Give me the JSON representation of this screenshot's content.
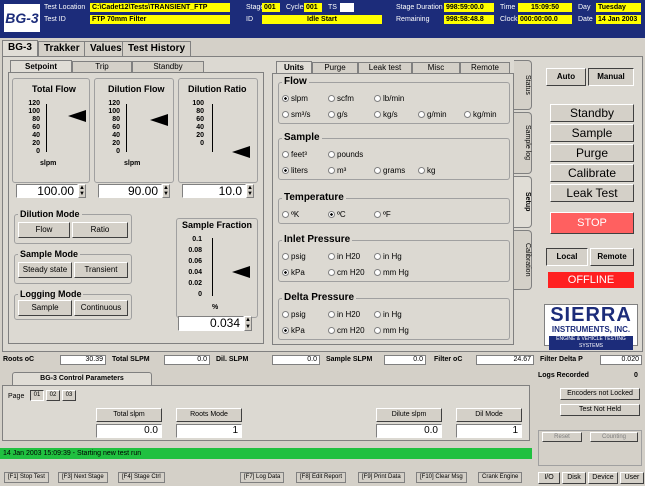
{
  "header": {
    "logo": "BG-3",
    "test_location_label": "Test Location",
    "test_location": "C:\\Cadet12\\Tests\\TRANSIENT_FTP",
    "test_id_label": "Test ID",
    "test_id": "FTP 70mm Filter",
    "stage_label": "Stage",
    "stage": "001",
    "cycle_label": "Cycle",
    "cycle": "001",
    "ts_label": "TS",
    "id_label": "ID",
    "status": "Idle Start",
    "stage_duration_label": "Stage Duration",
    "stage_duration": "998:59:00.0",
    "remaining_label": "Remaining",
    "remaining": "998:58:48.8",
    "time_label": "Time",
    "time": "15:09:50",
    "clock_label": "Clock",
    "clock": "000:00:00.0",
    "day_label": "Day",
    "day": "Tuesday",
    "date_label": "Date",
    "date": "14 Jan 2003"
  },
  "main_tabs": [
    "BG-3",
    "Trakker",
    "Values",
    "Test History"
  ],
  "left_tabs": [
    "Setpoint",
    "Trip",
    "Standby"
  ],
  "flows": [
    {
      "title": "Total Flow",
      "ticks": [
        "120",
        "100",
        "80",
        "60",
        "40",
        "20",
        "0"
      ],
      "unit": "slpm",
      "value": "100.00",
      "level": 0.83
    },
    {
      "title": "Dilution Flow",
      "ticks": [
        "120",
        "100",
        "80",
        "60",
        "40",
        "20",
        "0"
      ],
      "unit": "slpm",
      "value": "90.00",
      "level": 0.75
    },
    {
      "title": "Dilution Ratio",
      "ticks": [
        "100",
        "80",
        "60",
        "40",
        "20",
        "0"
      ],
      "unit": "",
      "value": "10.0",
      "level": 0.1
    }
  ],
  "dilution_mode": {
    "title": "Dilution Mode",
    "options": [
      "Flow",
      "Ratio"
    ]
  },
  "sample_mode": {
    "title": "Sample Mode",
    "options": [
      "Steady state",
      "Transient"
    ]
  },
  "logging_mode": {
    "title": "Logging Mode",
    "options": [
      "Sample",
      "Continuous"
    ]
  },
  "sample_fraction": {
    "title": "Sample Fraction",
    "ticks": [
      "0.1",
      "0.08",
      "0.06",
      "0.04",
      "0.02",
      "0"
    ],
    "unit": "%",
    "value": "0.034",
    "level": 0.34
  },
  "right_tabs": [
    "Units",
    "Purge",
    "Leak test",
    "Misc",
    "Remote"
  ],
  "units": {
    "flow": {
      "title": "Flow",
      "row1": [
        "slpm",
        "scfm",
        "lb/min"
      ],
      "row2": [
        "sm³/s",
        "g/s",
        "kg/s",
        "g/min",
        "kg/min"
      ]
    },
    "sample": {
      "title": "Sample",
      "row1": [
        "feet³",
        "pounds"
      ],
      "row2": [
        "liters",
        "m³",
        "grams",
        "kg"
      ]
    },
    "temperature": {
      "title": "Temperature",
      "row1": [
        "ºK",
        "ºC",
        "ºF"
      ]
    },
    "inlet_pressure": {
      "title": "Inlet Pressure",
      "row1": [
        "psig",
        "in H20",
        "in Hg"
      ],
      "row2": [
        "kPa",
        "cm H20",
        "mm Hg"
      ]
    },
    "delta_pressure": {
      "title": "Delta Pressure",
      "row1": [
        "psig",
        "in H20",
        "in Hg"
      ],
      "row2": [
        "kPa",
        "cm H20",
        "mm Hg"
      ]
    }
  },
  "side_tabs": [
    "Status",
    "Sample log",
    "Setup",
    "Calibration"
  ],
  "controls": {
    "auto": "Auto",
    "manual": "Manual",
    "standby": "Standby",
    "sample": "Sample",
    "purge": "Purge",
    "calibrate": "Calibrate",
    "leak_test": "Leak Test",
    "stop": "STOP",
    "local": "Local",
    "remote": "Remote",
    "offline": "OFFLINE"
  },
  "brand": {
    "line1": "SIERRA",
    "line2": "INSTRUMENTS, INC.",
    "line3": "ENGINE & VEHICLE TESTING SYSTEMS"
  },
  "readings": {
    "roots_label": "Roots oC",
    "roots": "30.39",
    "total_label": "Total SLPM",
    "total": "0.0",
    "dil_label": "Dil. SLPM",
    "dil": "0.0",
    "sample_label": "Sample SLPM",
    "sample": "0.0",
    "filter_label": "Filter oC",
    "filter": "24.67",
    "delta_label": "Filter Delta P",
    "delta": "0.020"
  },
  "control_params": {
    "tab": "BG-3 Control Parameters",
    "page_label": "Page",
    "pages": [
      "01",
      "02",
      "03"
    ],
    "fields": [
      {
        "label": "Total slpm",
        "value": "0.0"
      },
      {
        "label": "Roots Mode",
        "value": "1"
      },
      {
        "label": "Dilute slpm",
        "value": "0.0"
      },
      {
        "label": "Dil Mode",
        "value": "1"
      }
    ]
  },
  "logs": {
    "label": "Logs Recorded",
    "value": "0",
    "encoders": "Encoders not Locked",
    "test_held": "Test Not Held",
    "reset": "Reset",
    "counting": "Counting"
  },
  "status_msg": "14 Jan 2003 15:09:39 - Starting new test run",
  "fkeys": [
    "[F1] Stop Test",
    "[F3] Next Stage",
    "[F4] Stage Ctrl",
    "[F7] Log Data",
    "[F8] Edit Report",
    "[F9] Print Data",
    "[F10] Clear Msg",
    "Crank Engine"
  ],
  "bottom_right": [
    "I/O",
    "Disk",
    "Device",
    "User"
  ],
  "colors": {
    "header_bg": "#1c2c7a",
    "status_bar": "#20c040",
    "stop": "#ff6060",
    "offline": "#ff2020"
  }
}
